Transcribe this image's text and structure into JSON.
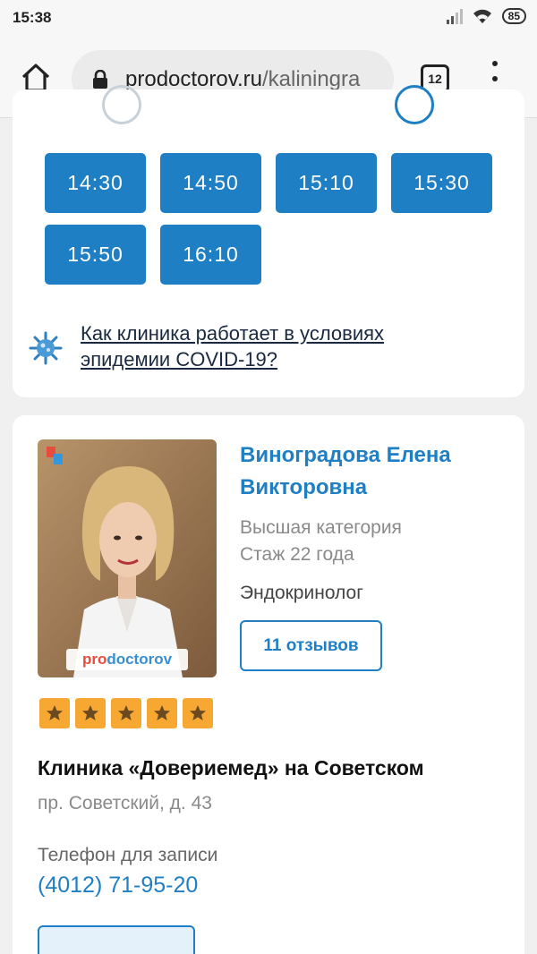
{
  "status_bar": {
    "time": "15:38",
    "battery": "85",
    "icons": [
      "signal-icon",
      "wifi-icon",
      "battery-icon"
    ]
  },
  "browser": {
    "url_domain": "prodoctorov.ru",
    "url_path": "/kaliningra",
    "tab_count": "12",
    "icons": [
      "home-icon",
      "lock-icon",
      "tabs-icon",
      "more-vert-icon"
    ]
  },
  "slots": {
    "times": [
      "14:30",
      "14:50",
      "15:10",
      "15:30",
      "15:50",
      "16:10"
    ],
    "color": "#1f7fc4"
  },
  "covid": {
    "link_text": "Как клиника работает в условиях эпидемии COVID-19?",
    "icon": "virus-icon"
  },
  "doctor": {
    "name": "Виноградова Елена Викторовна",
    "category": "Высшая категория",
    "experience": "Стаж 22 года",
    "specialty": "Эндокринолог",
    "reviews_label": "11 отзывов",
    "rating_stars": 5,
    "photo_watermark_pro": "pro",
    "photo_watermark_rest": "doctorov"
  },
  "clinic": {
    "name": "Клиника «Довериемед» на Советском",
    "address": "пр. Советский, д. 43",
    "phone_label": "Телефон для записи",
    "phone": "(4012) 71-95-20"
  },
  "colors": {
    "accent": "#1f7fc4",
    "star": "#f6a832",
    "background": "#f0f0f0"
  }
}
